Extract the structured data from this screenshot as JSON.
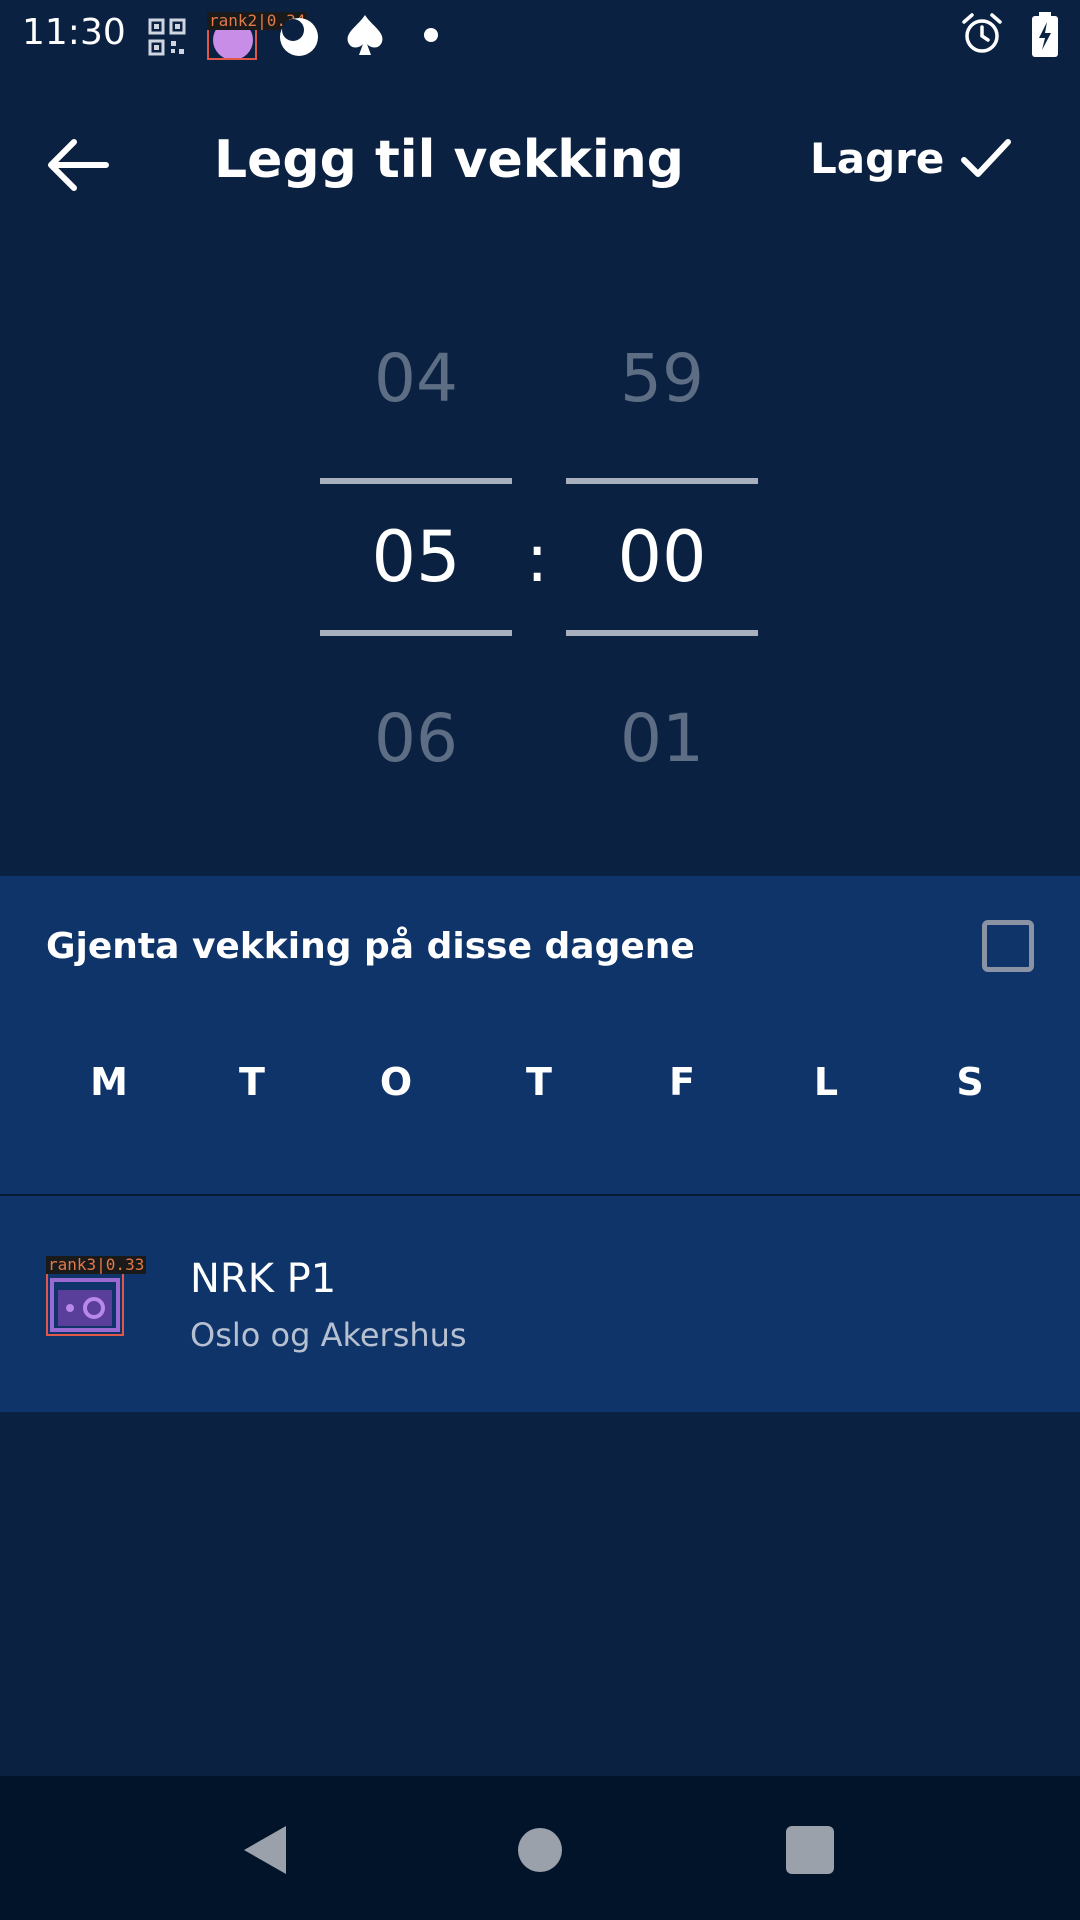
{
  "status_bar": {
    "time": "11:30",
    "annotations": [
      "rank2|0.34",
      "rank3|0.33"
    ]
  },
  "app_bar": {
    "title": "Legg til vekking",
    "save_label": "Lagre"
  },
  "time_picker": {
    "hour_prev": "04",
    "hour_selected": "05",
    "hour_next": "06",
    "minute_prev": "59",
    "minute_selected": "00",
    "minute_next": "01",
    "separator": ":"
  },
  "repeat": {
    "label": "Gjenta vekking på disse dagene",
    "checked": false,
    "days": [
      "M",
      "T",
      "O",
      "T",
      "F",
      "L",
      "S"
    ]
  },
  "station": {
    "name": "NRK P1",
    "region": "Oslo og Akershus"
  },
  "colors": {
    "background": "#0b2141",
    "section": "#0e346a",
    "nav_bar": "#02142a",
    "annotation_box": "#e0584a"
  }
}
